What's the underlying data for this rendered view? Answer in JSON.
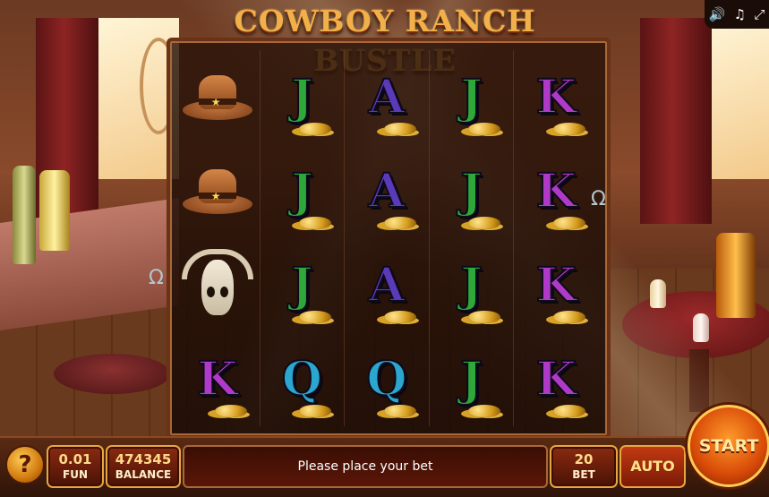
{
  "game": {
    "title": "COWBOY RANCH BUSTLE"
  },
  "top_icons": [
    {
      "name": "sound-icon",
      "glyph": "🔊"
    },
    {
      "name": "music-icon",
      "glyph": "♫"
    },
    {
      "name": "fullscreen-icon",
      "glyph": "⤢"
    }
  ],
  "reels": [
    [
      "hat",
      "hat",
      "skull",
      "K"
    ],
    [
      "J",
      "J",
      "J",
      "Q"
    ],
    [
      "A",
      "A",
      "A",
      "Q"
    ],
    [
      "J",
      "J",
      "J",
      "J"
    ],
    [
      "K",
      "K",
      "K",
      "K"
    ]
  ],
  "symbol_colors": {
    "J": "#2fa83a",
    "A": "#5a3ab8",
    "K": "#b03ac8",
    "Q": "#2aa6cf"
  },
  "controls": {
    "help_label": "?",
    "coin_value": "0.01",
    "coin_label": "FUN",
    "balance_value": "474345",
    "balance_label": "BALANCE",
    "message": "Please place your bet",
    "bet_value": "20",
    "bet_label": "BET",
    "auto_label": "AUTO",
    "start_label": "START"
  }
}
